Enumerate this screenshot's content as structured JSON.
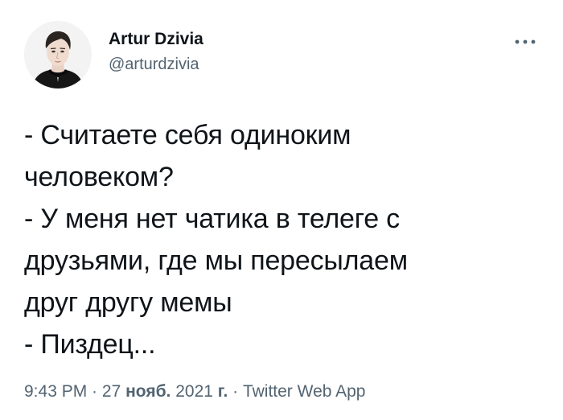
{
  "author": {
    "display_name": "Artur Dzivia",
    "handle": "@arturdzivia",
    "avatar_icon": "profile-portrait"
  },
  "menu": {
    "icon": "more-horizontal-icon"
  },
  "tweet": {
    "lines": [
      "- Считаете себя одиноким",
      "человеком?",
      "- У меня нет чатика в телеге с",
      "друзьями, где мы пересылаем",
      "друг другу мемы",
      "- Пиздец..."
    ]
  },
  "meta": {
    "time": "9:43 PM",
    "sep1": " · ",
    "day": "27",
    "month": "нояб.",
    "year": "2021",
    "year_suffix": "г.",
    "sep2": " · ",
    "source": "Twitter Web App"
  },
  "colors": {
    "text": "#0f1419",
    "secondary": "#536471",
    "background": "#ffffff"
  }
}
